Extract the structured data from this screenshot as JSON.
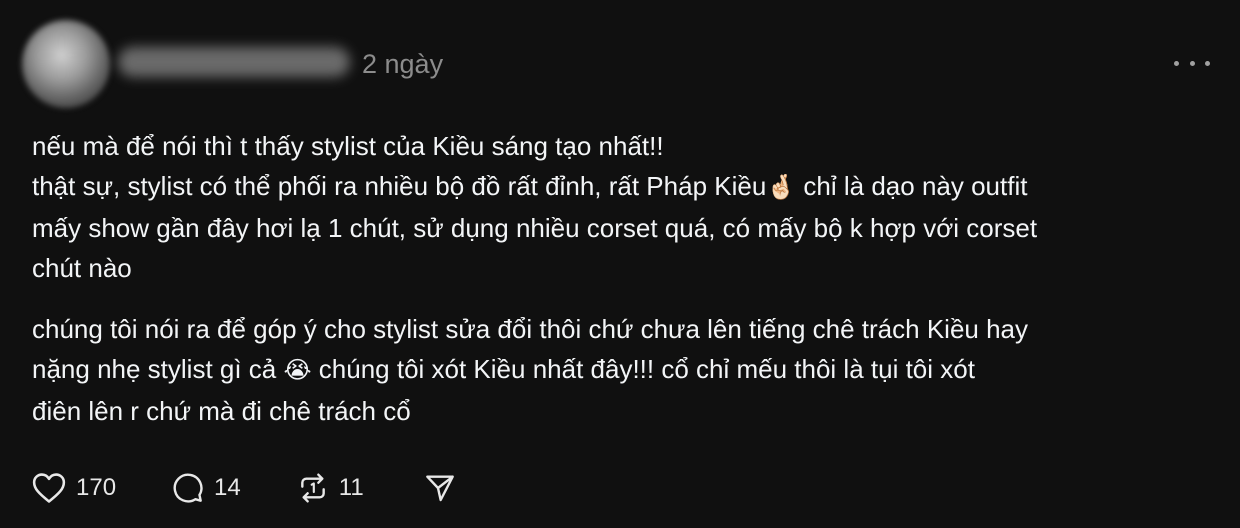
{
  "post": {
    "timestamp": "2 ngày",
    "content": {
      "lines": [
        "nếu mà để nói thì t thấy stylist của Kiều sáng tạo nhất!!",
        "thật sự, stylist có thể phối ra nhiều bộ đồ rất đỉnh, rất Pháp Kiều",
        "chỉ là dạo này outfit",
        "mấy show gần đây hơi lạ 1 chút, sử dụng nhiều corset quá, có mấy bộ k hợp với corset",
        "chút nào",
        "chúng tôi nói ra để góp ý cho stylist sửa đổi thôi chứ chưa lên tiếng chê trách Kiều hay",
        "nặng nhẹ stylist gì cả",
        "chúng tôi xót Kiều nhất đây!!! cổ chỉ mếu thôi là tụi tôi xót",
        "điên lên r chứ mà đi chê trách cổ"
      ],
      "emojis": {
        "hand": "🤞🏻",
        "cry": "😭"
      }
    },
    "actions": {
      "likes": "170",
      "replies": "14",
      "reposts": "11"
    },
    "icons": {
      "like": "heart-icon",
      "reply": "comment-icon",
      "repost": "repost-icon",
      "share": "send-icon",
      "more": "more-icon"
    },
    "colors": {
      "background": "#101010",
      "text": "#f3f5f7",
      "muted": "#8c8c8c"
    }
  }
}
